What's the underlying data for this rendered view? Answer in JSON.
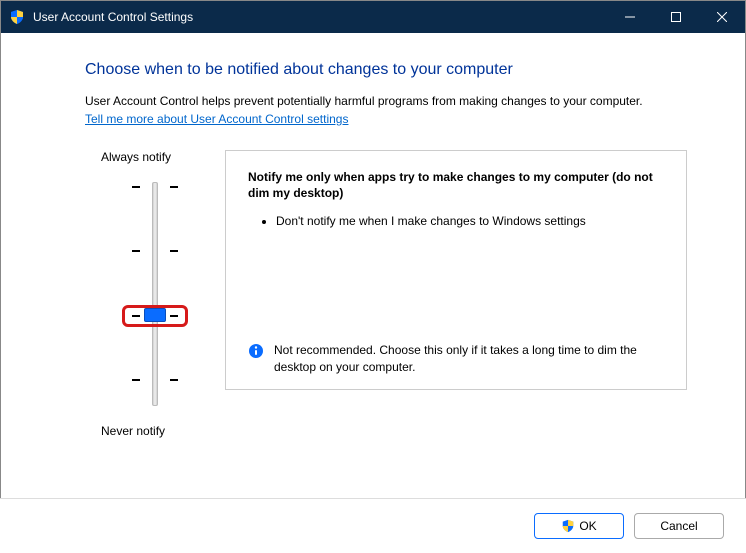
{
  "window": {
    "title": "User Account Control Settings"
  },
  "main": {
    "heading": "Choose when to be notified about changes to your computer",
    "intro": "User Account Control helps prevent potentially harmful programs from making changes to your computer.",
    "link": "Tell me more about User Account Control settings"
  },
  "slider": {
    "top_label": "Always notify",
    "bottom_label": "Never notify",
    "levels": 4,
    "current_level_index": 2
  },
  "panel": {
    "title": "Notify me only when apps try to make changes to my computer (do not dim my desktop)",
    "bullets": [
      "Don't notify me when I make changes to Windows settings"
    ],
    "note": "Not recommended. Choose this only if it takes a long time to dim the desktop on your computer."
  },
  "footer": {
    "ok_label": "OK",
    "cancel_label": "Cancel"
  }
}
